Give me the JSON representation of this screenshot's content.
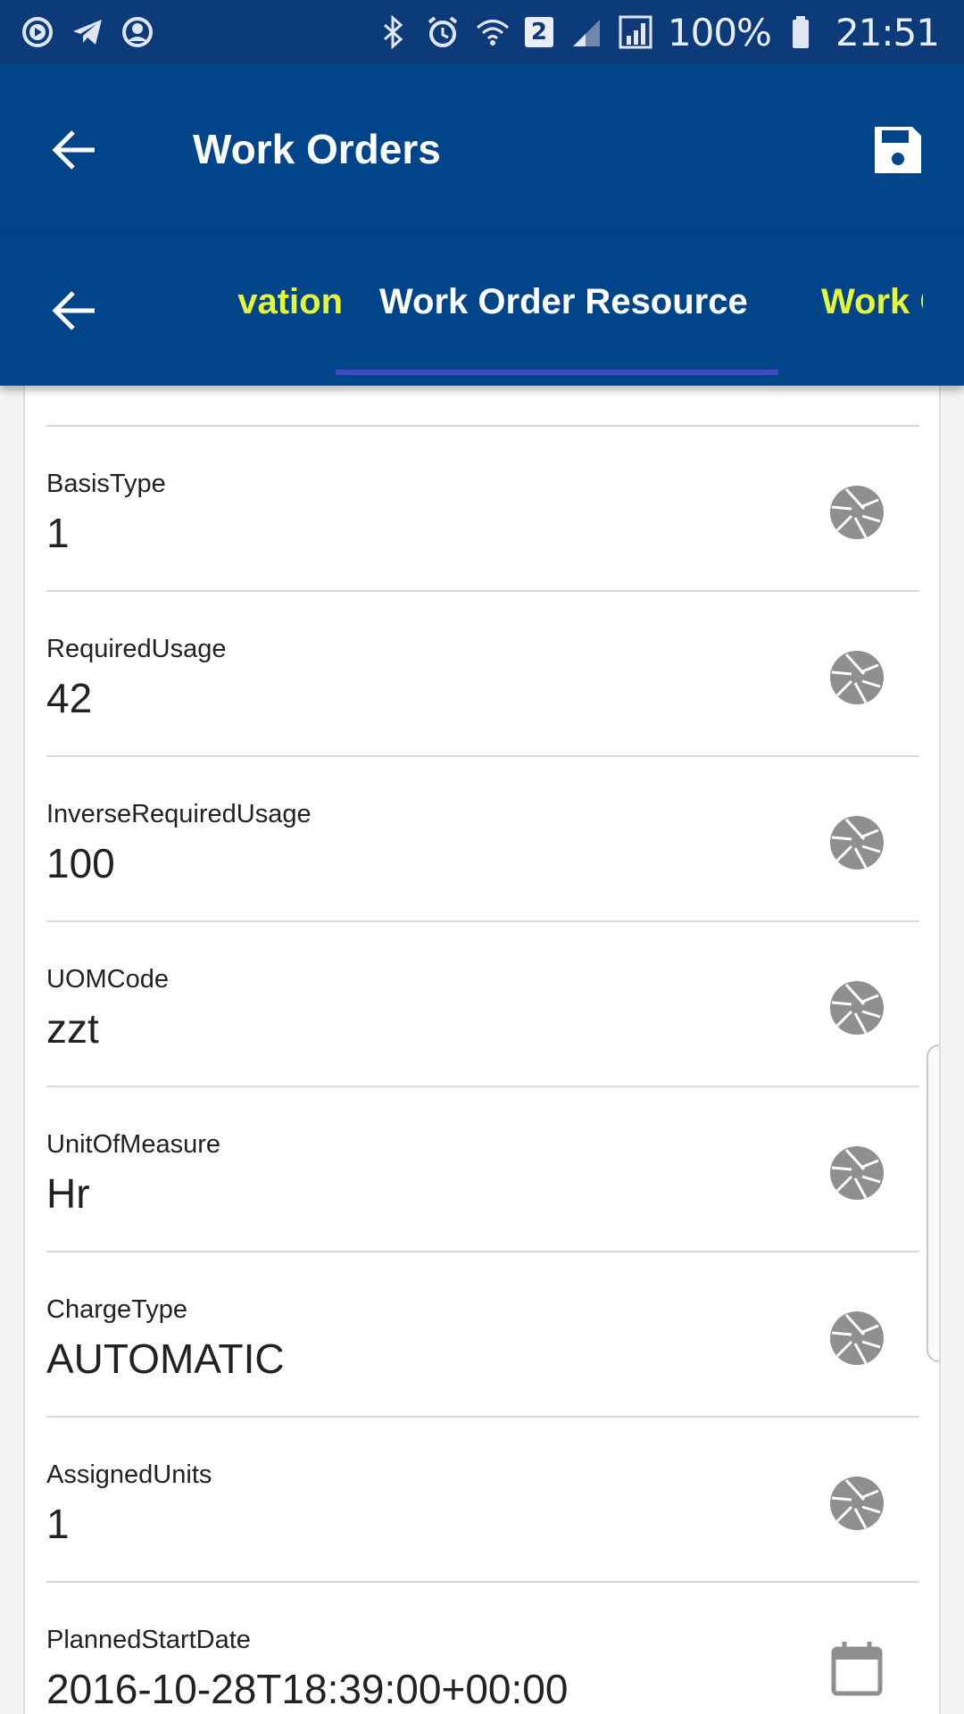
{
  "status_bar": {
    "battery": "100%",
    "time": "21:51",
    "sim_badge": "2"
  },
  "app_bar": {
    "title": "Work Orders"
  },
  "tabs": {
    "prev": "vation",
    "active": "Work Order Resource",
    "next": "Work O"
  },
  "fields": [
    {
      "label": "BasisType",
      "value": "1",
      "icon": "aperture-icon"
    },
    {
      "label": "RequiredUsage",
      "value": "42",
      "icon": "aperture-icon"
    },
    {
      "label": "InverseRequiredUsage",
      "value": "100",
      "icon": "aperture-icon"
    },
    {
      "label": "UOMCode",
      "value": "zzt",
      "icon": "aperture-icon"
    },
    {
      "label": "UnitOfMeasure",
      "value": "Hr",
      "icon": "aperture-icon"
    },
    {
      "label": "ChargeType",
      "value": "AUTOMATIC",
      "icon": "aperture-icon"
    },
    {
      "label": "AssignedUnits",
      "value": "1",
      "icon": "aperture-icon"
    },
    {
      "label": "PlannedStartDate",
      "value": "2016-10-28T18:39:00+00:00",
      "icon": "calendar-icon"
    }
  ],
  "colors": {
    "app_bar": "#004589",
    "status_bar": "#0d3a78",
    "tab_inactive": "#e7f43c",
    "tab_indicator": "#3e48c8",
    "icon_gray": "#8f8f8f"
  }
}
